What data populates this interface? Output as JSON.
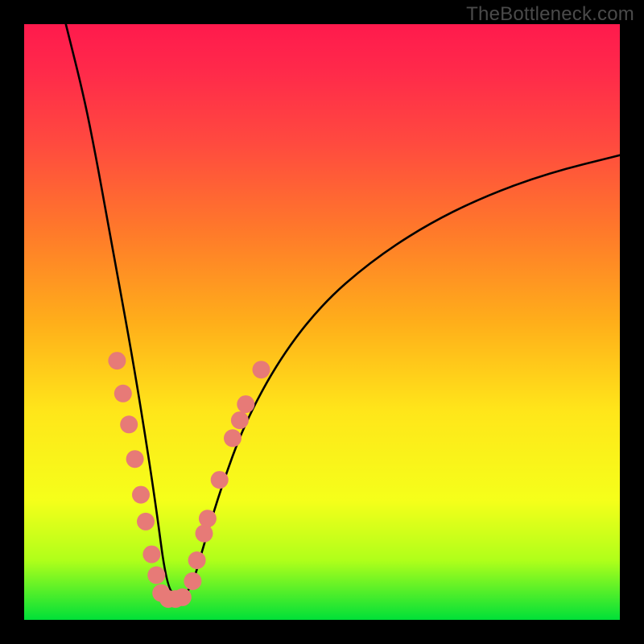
{
  "watermark": "TheBottleneck.com",
  "chart_data": {
    "type": "line",
    "title": "",
    "xlabel": "",
    "ylabel": "",
    "xlim": [
      0,
      100
    ],
    "ylim": [
      0,
      100
    ],
    "note": "Bottleneck curve: steep left descent to a minimum near x≈24, then a rising curve approaching y≈78 at right edge. Axes are unlabeled; values are visual estimates from pixel positions.",
    "series": [
      {
        "name": "bottleneck-curve",
        "x": [
          7,
          10,
          12,
          14,
          16,
          18,
          20,
          22,
          24,
          26,
          28,
          30,
          33,
          37,
          43,
          50,
          58,
          67,
          77,
          88,
          100
        ],
        "y": [
          100,
          88,
          78,
          67,
          56,
          45,
          33,
          20,
          5,
          4,
          5,
          12,
          22,
          33,
          44,
          53,
          60,
          66,
          71,
          75,
          78
        ]
      }
    ],
    "markers": {
      "name": "highlight-dots",
      "color": "#e77a77",
      "radius_px": 11,
      "points": [
        {
          "x": 15.6,
          "y": 43.5
        },
        {
          "x": 16.6,
          "y": 38.0
        },
        {
          "x": 17.6,
          "y": 32.8
        },
        {
          "x": 18.6,
          "y": 27.0
        },
        {
          "x": 19.6,
          "y": 21.0
        },
        {
          "x": 20.4,
          "y": 16.5
        },
        {
          "x": 21.4,
          "y": 11.0
        },
        {
          "x": 22.2,
          "y": 7.5
        },
        {
          "x": 23.0,
          "y": 4.5
        },
        {
          "x": 24.2,
          "y": 3.5
        },
        {
          "x": 25.4,
          "y": 3.5
        },
        {
          "x": 26.6,
          "y": 3.8
        },
        {
          "x": 28.3,
          "y": 6.5
        },
        {
          "x": 29.0,
          "y": 10.0
        },
        {
          "x": 30.2,
          "y": 14.5
        },
        {
          "x": 30.8,
          "y": 17.0
        },
        {
          "x": 32.8,
          "y": 23.5
        },
        {
          "x": 35.0,
          "y": 30.5
        },
        {
          "x": 36.2,
          "y": 33.5
        },
        {
          "x": 37.2,
          "y": 36.2
        },
        {
          "x": 39.8,
          "y": 42.0
        }
      ]
    }
  }
}
